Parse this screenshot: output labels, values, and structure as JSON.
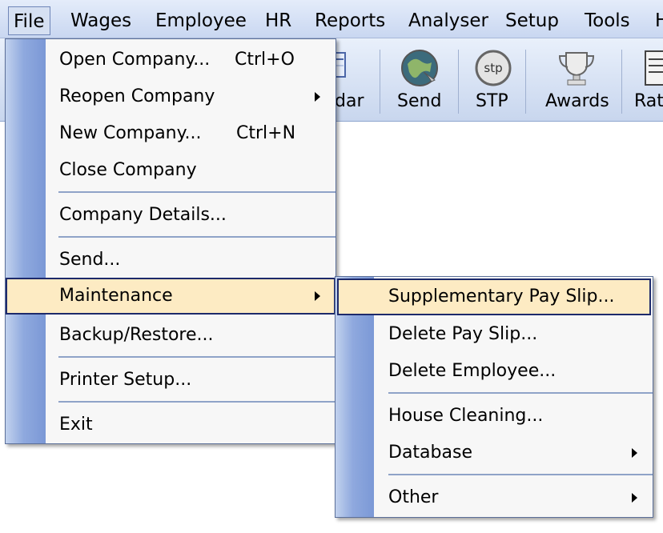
{
  "menubar": {
    "items": [
      "File",
      "Wages",
      "Employee",
      "HR",
      "Reports",
      "Analyser",
      "Setup",
      "Tools",
      "H"
    ]
  },
  "toolbar": {
    "calendar_partial_label": "dar",
    "send_label": "Send",
    "stp_label": "STP",
    "stp_icon_text": "stp",
    "awards_label": "Awards",
    "rates_partial_label": "Rat"
  },
  "file_menu": {
    "open": {
      "label": "Open Company...",
      "shortcut": "Ctrl+O"
    },
    "reopen": {
      "label": "Reopen Company"
    },
    "new": {
      "label": "New Company...",
      "shortcut": "Ctrl+N"
    },
    "close": {
      "label": "Close Company"
    },
    "details": {
      "label": "Company Details..."
    },
    "send": {
      "label": "Send..."
    },
    "maintenance": {
      "label": "Maintenance"
    },
    "backup": {
      "label": "Backup/Restore..."
    },
    "printer": {
      "label": "Printer Setup..."
    },
    "exit": {
      "label": "Exit"
    }
  },
  "maintenance_menu": {
    "supplementary": {
      "label": "Supplementary Pay Slip..."
    },
    "delete_payslip": {
      "label": "Delete Pay Slip..."
    },
    "delete_employee": {
      "label": "Delete Employee..."
    },
    "house_cleaning": {
      "label": "House Cleaning..."
    },
    "database": {
      "label": "Database"
    },
    "other": {
      "label": "Other"
    }
  },
  "colors": {
    "highlight": "#fdebc3",
    "highlight_border": "#1d2a6b",
    "gutter": "#8fa9de",
    "menubar": "#c9d7f1"
  }
}
